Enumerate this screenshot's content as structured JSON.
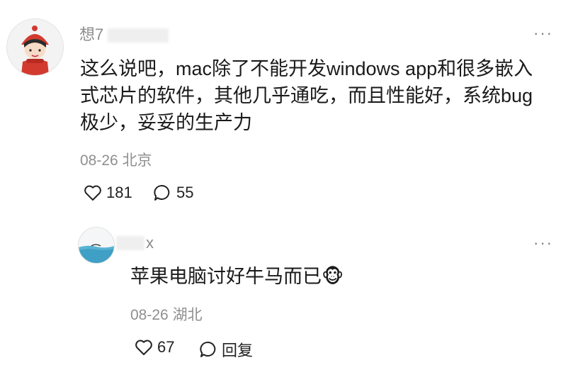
{
  "comment": {
    "username": "想7",
    "content_lines": [
      "这么说吧，mac除了不能开发windows app和很多嵌入",
      "式芯片的软件，其他几乎通吃，而且性能好，系统bug",
      "极少，妥妥的生产力"
    ],
    "date": "08-26",
    "location": "北京",
    "like_count": "181",
    "reply_count": "55",
    "more_label": "···"
  },
  "reply": {
    "username": "x",
    "content": "苹果电脑讨好牛马而已",
    "emoji": "🐵",
    "date": "08-26",
    "location": "湖北",
    "like_count": "67",
    "reply_label": "回复",
    "more_label": "···"
  }
}
